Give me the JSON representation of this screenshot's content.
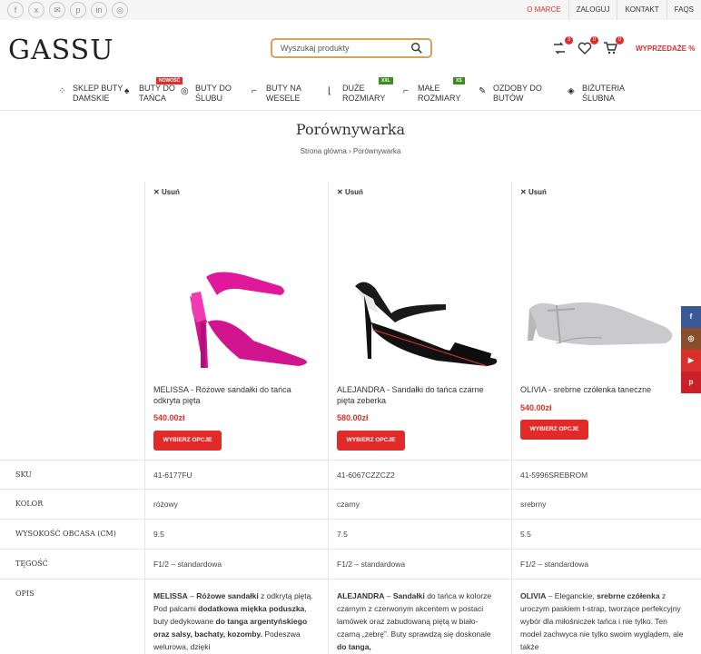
{
  "topbar": {
    "social": [
      "f",
      "x",
      "✉",
      "p",
      "in",
      "◎"
    ],
    "links": [
      "O MARCE",
      "ZALOGUJ",
      "KONTAKT",
      "FAQS"
    ]
  },
  "header": {
    "logo": "GASSU",
    "search_placeholder": "Wyszukaj produkty",
    "badges": {
      "compare": "3",
      "wishlist": "0",
      "cart": "0"
    },
    "sale": "WYPRZEDAŻE %"
  },
  "nav": [
    {
      "l1": "SKLEP BUTY",
      "l2": "DAMSKIE",
      "badge": ""
    },
    {
      "l1": "BUTY DO",
      "l2": "TAŃCA",
      "badge": "NOWOŚĆ"
    },
    {
      "l1": "BUTY DO",
      "l2": "ŚLUBU",
      "badge": ""
    },
    {
      "l1": "BUTY NA",
      "l2": "WESELE",
      "badge": ""
    },
    {
      "l1": "DUŻE",
      "l2": "ROZMIARY",
      "badge": "XXL"
    },
    {
      "l1": "MAŁE",
      "l2": "ROZMIARY",
      "badge": "XS"
    },
    {
      "l1": "OZDOBY DO",
      "l2": "BUTÓW",
      "badge": ""
    },
    {
      "l1": "BIŻUTERIA",
      "l2": "ŚLUBNA",
      "badge": ""
    }
  ],
  "page": {
    "title": "Porównywarka",
    "breadcrumb": "Strona główna › Porównywarka"
  },
  "compare": {
    "remove_label": "Usuń",
    "button_label": "WYBIERZ OPCJE",
    "row_labels": [
      "SKU",
      "KOLOR",
      "WYSOKOŚĆ OBCASA (CM)",
      "TĘGOŚĆ",
      "OPIS"
    ],
    "products": [
      {
        "name": "MELISSA - Różowe sandałki do tańca odkryta pięta",
        "price": "540.00zł",
        "sku": "41-6177FU",
        "color": "różowy",
        "heel": "9.5",
        "width": "F1/2 – standardowa",
        "shoe_color": "#e0189a"
      },
      {
        "name": "ALEJANDRA - Sandałki do tańca czarne pięta zeberka",
        "price": "580.00zł",
        "sku": "41-6067CZZCZ2",
        "color": "czarny",
        "heel": "7.5",
        "width": "F1/2 – standardowa",
        "shoe_color": "#1a1a1a"
      },
      {
        "name": "OLIVIA - srebrne czółenka taneczne",
        "price": "540.00zł",
        "sku": "41-5996SREBROM",
        "color": "srebrny",
        "heel": "5.5",
        "width": "F1/2 – standardowa",
        "shoe_color": "#c9c9cc"
      }
    ],
    "descriptions": [
      {
        "a": "MELISSA",
        "b": " – ",
        "c": "Różowe sandałki",
        "d": " z odkrytą piętą. Pod palcami ",
        "e": "dodatkowa miękka poduszka",
        "f": ", buty dedykowane ",
        "g": "do tanga argentyńskiego oraz salsy, bachaty, kozomby.",
        "h": " Podeszwa welurowa, dzięki"
      },
      {
        "a": "ALEJANDRA",
        "b": " – ",
        "c": "Sandałki",
        "d": " do tańca w kolorze czarnym z czerwonym akcentem w postaci lamówek oraz zabudowaną piętą w biało-czarną „zebrę”. Buty sprawdzą się doskonale ",
        "e": "do tanga,",
        "f": "",
        "g": "",
        "h": ""
      },
      {
        "a": "OLIVIA",
        "b": " – Eleganckie, ",
        "c": "srebrne czółenka",
        "d": " z uroczym paskiem t-strap, tworzące perfekcyjny wybór dla miłośniczek tańca i nie tylko. Ten model zachwyca nie tylko swoim wyglądem, ale także",
        "e": "",
        "f": "",
        "g": "",
        "h": ""
      }
    ]
  },
  "side_social": [
    "f",
    "◎",
    "▶",
    "p"
  ]
}
